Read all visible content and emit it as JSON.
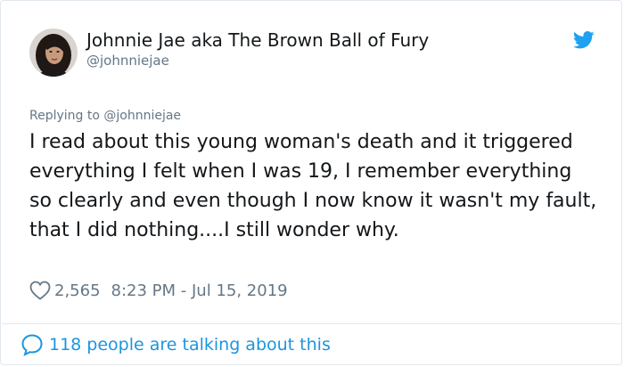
{
  "tweet": {
    "author_display_name": "Johnnie Jae aka The Brown Ball of Fury",
    "author_handle": "@johnniejae",
    "replying_to": "Replying to @johnniejae",
    "text": "I read about this young woman's death and it triggered everything I felt when I was 19, I remember everything so clearly and even though I now know it wasn't my fault, that I did nothing....I still wonder why.",
    "like_count": "2,565",
    "timestamp": "8:23 PM - Jul 15, 2019",
    "talking_about": "118 people are talking about this"
  },
  "colors": {
    "text_primary": "#14171a",
    "text_secondary": "#657786",
    "twitter_blue": "#1da1f2",
    "link_blue": "#1b95e0",
    "border": "#e1e8ed"
  },
  "icons": {
    "brand": "twitter-bird-icon",
    "like": "heart-icon",
    "reply": "speech-bubble-icon"
  }
}
